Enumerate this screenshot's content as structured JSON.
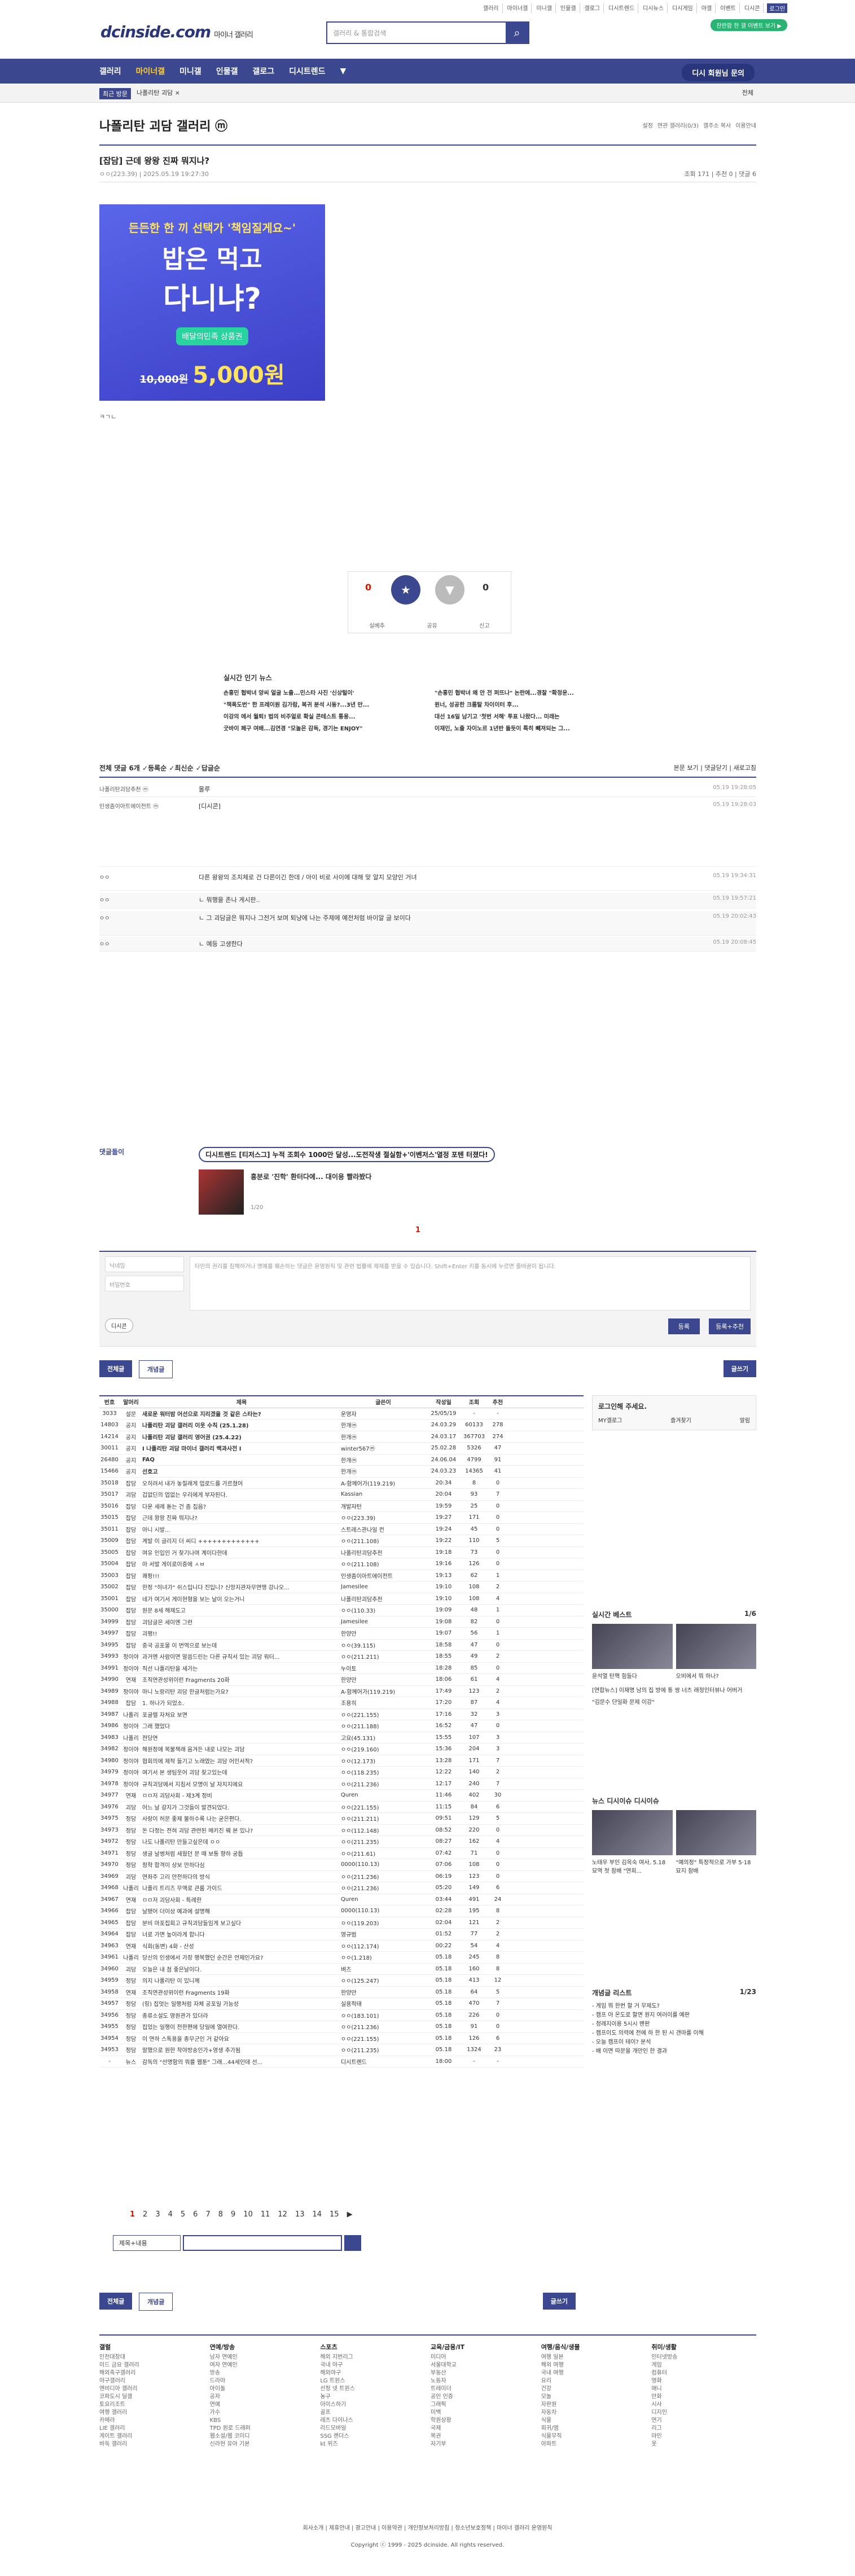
{
  "top_menu": [
    "갤러리",
    "마이너갤",
    "미니갤",
    "인물갤",
    "갤로그",
    "디시트렌드",
    "디시뉴스",
    "디시게임",
    "야갤",
    "이벤트",
    "디시콘",
    "로그인"
  ],
  "promo_button": "찬란함 한 갤 이벤트 보기 ▶",
  "logo": {
    "main": "dcinside.com",
    "sub": "마이너 갤러리"
  },
  "search_placeholder": "갤러리 & 통합검색",
  "gnb": {
    "items": [
      "갤러리",
      "마이너갤",
      "미니갤",
      "인물갤",
      "갤로그",
      "디시트렌드",
      "▼"
    ],
    "active": 1,
    "right": "디시 회원님 문의"
  },
  "sub": {
    "tag": "최근 방문",
    "text": "나폴리탄 괴담 ×",
    "right": "전체"
  },
  "gallery": {
    "title": "나폴리탄 괴담 갤러리 ⓜ",
    "right": [
      "설정",
      "연관 갤러리(0/3)",
      "갤주소 복사",
      "이용안내"
    ]
  },
  "post": {
    "title": "[잡담] 근데 왕왕 진짜 뭐지나?",
    "author": "ㅇㅇ(223.39)",
    "date": "2025.05.19 19:27:30",
    "stats": "조회 171  |  추천 0  |  댓글 6",
    "body": "ㅋㄱㄴ"
  },
  "banner": {
    "t1": "든든한 한 끼 선택가 '책임질게요~'",
    "t2": "밥은 먹고",
    "t3": "다니냐?",
    "pill": "배달의민족 상품권",
    "old": "10,000원",
    "price": "5,000원"
  },
  "vote": {
    "up": "0",
    "fix": "고정 0",
    "down": "0",
    "acts": [
      "실베추",
      "공유",
      "신고"
    ]
  },
  "news": {
    "title": "실시간 인기 뉴스",
    "items": [
      "손흥민 협박녀 양씨 얼굴 노출...민스타 사진 '신상털이'",
      "\"책폭도번\" 한 프레이원 김가람, 복귀 분석 시동?...3년 만...",
      "이강의 에서 월퇴! 법의 비주얼로 확실 콘테스트 통용...",
      "굿바이 페구 여배...김연경 \"모놀은 감독, 경기는 ENJOY\"",
      "\"손흥민 협박녀 왜 안 전 퍼뜨나\" 논란에...경찰 \"확정운...",
      "윈너, 성공한 크롬탈 차이이터 후...",
      "대선 16일 남기고 '첫번 서해' 투표 나왔다... 미래는",
      "이재인, 노출 자이노르 1년반 돌듯이 특히 빼져되는 그..."
    ]
  },
  "comments": {
    "header": "전체 댓글 6개  ✓등록순  ✓최신순  ✓답글순",
    "right": "본문 보기  |  댓글닫기  |  새로고침",
    "rows": [
      {
        "nick": "나폴리탄괴담추천 ⓜ",
        "text": "몰루",
        "date": "05.19 19:28:05"
      },
      {
        "nick": "인생좀이아트에이전트 ⓜ",
        "text": "[디시콘]",
        "date": "05.19 19:28:03"
      },
      {
        "nick": "ㅇㅇ",
        "text": "다른 왕왕의 조치체로 건 다른이긴 한데 / 아이 비로 사이에 대해 맞 알지 모양인 거녀",
        "date": "05.19 19:34:31"
      },
      {
        "nick": "ㅇㅇ",
        "text": "ㄴ 뭐행을 존나 게시판..",
        "date": "05.19 19:57:21"
      },
      {
        "nick": "ㅇㅇ",
        "text": "ㄴ 그 괴담글은 뭐지나 그전거 보며 퇴냥에 나는 주제에 예전처럼 바이알 글 보이다",
        "date": "05.19 20:02:43"
      },
      {
        "nick": "ㅇㅇ",
        "text": "ㄴ 예등 고생한다",
        "date": "05.19 20:08:45"
      }
    ]
  },
  "best": {
    "label": "댓글돌이",
    "pill": "디시트렌드 [티저스그] 누적 조회수 1000만 달성...도전작생 절실함+'이벤저스'열정 포텐 터졌다!",
    "tt": "흥분로 '진학' 환터다에... 대이용 빨라봤다",
    "meta": "1/20"
  },
  "page_num": "1",
  "write": {
    "nick": "닉네임",
    "pw": "비밀번호",
    "ta": "타인의 권리를 침해하거나 명예를 훼손하는 댓글은 운영원칙 및 관련 법률에 제재를 받을 수 있습니다. Shift+Enter 키를 동시에 누르면 줄바꿈이 됩니다.",
    "dc": "디시콘",
    "submit": "등록",
    "submit2": "등록+추천"
  },
  "buttons": {
    "all": "전체글",
    "recom": "개념글",
    "write": "글쓰기"
  },
  "list_header": [
    "번호",
    "말머리",
    "제목",
    "글쓴이",
    "작성일",
    "조회",
    "추천"
  ],
  "list": [
    [
      "3033",
      "설문",
      "새로운 워터밤 어선으로 지리겠을 것 같은 스타는?",
      "운영자",
      "25/05/19",
      "-",
      "-"
    ],
    [
      "14803",
      "공지",
      "나폴리탄 괴담 갤러리 이웃 수칙 (25.1.28)",
      "한개ⓜ",
      "24.03.29",
      "60133",
      "278"
    ],
    [
      "14214",
      "공지",
      "나폴리탄 괴담 갤러리 영어권 (25.4.22)",
      "한개ⓜ",
      "24.03.17",
      "367703",
      "274"
    ],
    [
      "30011",
      "공지",
      "I 나폴리탄 괴담 마이너 갤러리 백과사전 I",
      "winter567ⓜ",
      "25.02.28",
      "5326",
      "47"
    ],
    [
      "26480",
      "공지",
      "FAQ",
      "한개ⓜ",
      "24.06.04",
      "4799",
      "91"
    ],
    [
      "15466",
      "공지",
      "선호고",
      "한개ⓜ",
      "24.03.23",
      "14365",
      "41"
    ],
    [
      "35018",
      "잡담",
      "오히려서 내가 놓칠래게 업로드를 가르쳤어",
      "A-함께어가(119.219)",
      "20:34",
      "8",
      "0"
    ],
    [
      "35017",
      "괴담",
      "겁없딘의 업없는 우리에게 부자된다.",
      "Kassian",
      "20:04",
      "93",
      "7"
    ],
    [
      "35016",
      "잡담",
      "다운 세례 돋는 건 좀 집음?",
      "개발자턴",
      "19:59",
      "25",
      "0"
    ],
    [
      "35015",
      "잡담",
      "근데 왕왕 진짜 뭐지나?",
      "ㅇㅇ(223.39)",
      "19:27",
      "171",
      "0"
    ],
    [
      "35011",
      "잡담",
      "아니 시발...",
      "스트레스관나일 컨",
      "19:24",
      "45",
      "0"
    ],
    [
      "35009",
      "잡담",
      "계발 이 글리지 더 씨디 +++++++++++++",
      "ㅇㅇ(211.108)",
      "19:22",
      "110",
      "5"
    ],
    [
      "35005",
      "잡담",
      "여유 인입인 거 찾기나며 계이다한데",
      "나폴리탄괴담추천",
      "19:18",
      "73",
      "0"
    ],
    [
      "35004",
      "잡담",
      "아 서발 게이로이증에 ㅅㅂ",
      "ㅇㅇ(211.108)",
      "19:16",
      "126",
      "0"
    ],
    [
      "35003",
      "잡담",
      "쾌펑!!!",
      "인생좀이아트에이전트",
      "19:13",
      "62",
      "1"
    ],
    [
      "35002",
      "잡담",
      "한정 \"히녀가\" 쉬스입니다 진입니? 신앙지관자무연맹 강나오...",
      "Jamesilee",
      "19:10",
      "108",
      "2"
    ],
    [
      "35001",
      "잡담",
      "네가 여기서 게이현형을 보는 날이 오는거니",
      "나폴리탄괴담추천",
      "19:10",
      "108",
      "4"
    ],
    [
      "35000",
      "잡담",
      "원문 8세 해제도고",
      "ㅇㅇ(110.33)",
      "19:09",
      "48",
      "1"
    ],
    [
      "34999",
      "잡담",
      "괴담글은 세이엔 그런",
      "Jamesilee",
      "19:08",
      "82",
      "0"
    ],
    [
      "34997",
      "잡담",
      "괴팽!!",
      "한양만",
      "19:07",
      "56",
      "1"
    ],
    [
      "34995",
      "잡담",
      "중국 공포물 이 번역으로 보는데",
      "ㅇㅇ(39.115)",
      "18:58",
      "47",
      "0"
    ],
    [
      "34993",
      "정이야",
      "과거엔 사람이면 말씀드린는 다른 규칙서 있는 괴담 워터...",
      "ㅇㅇ(211.211)",
      "18:55",
      "49",
      "2"
    ],
    [
      "34991",
      "정이야",
      "직선 나폴리탄을 세가는",
      "누이토",
      "18:28",
      "85",
      "0"
    ],
    [
      "34990",
      "연재",
      "조직연관성위이런 Fragments 20화",
      "한양만",
      "18:06",
      "61",
      "4"
    ],
    [
      "34989",
      "정이야",
      "마니 노랑리탄 괴담 한글처럼는가요?",
      "A-함께어가(119.219)",
      "17:49",
      "123",
      "2"
    ],
    [
      "34988",
      "잡담",
      "1. 하나가 되었소.",
      "조용히",
      "17:20",
      "87",
      "4"
    ],
    [
      "34987",
      "나폴리",
      "포굴렐 자처요 보면",
      "ㅇㅇ(221.155)",
      "17:16",
      "32",
      "3"
    ],
    [
      "34986",
      "정이야",
      "그래 했었다",
      "ㅇㅇ(211.188)",
      "16:52",
      "47",
      "0"
    ],
    [
      "34983",
      "나폴리",
      "전당연",
      "고요(45.131)",
      "15:55",
      "107",
      "3"
    ],
    [
      "34982",
      "정이야",
      "해원정애 복불책래 음겨든 내로 나모는 괴담",
      "ㅇㅇ(219.160)",
      "15:36",
      "204",
      "3"
    ],
    [
      "34980",
      "정이야",
      "협회의에 제작 들기고 노래였는 괴담 어인서적?",
      "ㅇㅇ(12.173)",
      "13:28",
      "171",
      "7"
    ],
    [
      "34979",
      "정이야",
      "여기서 본 생팀웃어 괴담 찾고있는데",
      "ㅇㅇ(118.235)",
      "12:22",
      "140",
      "2"
    ],
    [
      "34978",
      "정이야",
      "규칙괴담에서 지침서 모명이 날 자치지에요",
      "ㅇㅇ(211.236)",
      "12:17",
      "240",
      "7"
    ],
    [
      "34977",
      "연재",
      "ㅁㅁ저 괴담사회 - 제3계 정비",
      "Quren",
      "11:46",
      "402",
      "30"
    ],
    [
      "34976",
      "괴담",
      "어느 날 갈지가 그것들이 발견되었다.",
      "ㅇㅇ(221.155)",
      "11:15",
      "84",
      "6"
    ],
    [
      "34975",
      "정담",
      "사랑이 허문 좋제 불하수록 나는 굳은편다.",
      "ㅇㅇ(211.211)",
      "09:51",
      "129",
      "5"
    ],
    [
      "34973",
      "정담",
      "돈 다정는 전혀 괴담 관련된 메키진 웨 본 있나?",
      "ㅇㅇ(112.148)",
      "08:52",
      "220",
      "0"
    ],
    [
      "34972",
      "정담",
      "나도 나폴리탄 만들고싶은데 ㅇㅇ",
      "ㅇㅇ(211.235)",
      "08:27",
      "162",
      "4"
    ],
    [
      "34971",
      "정담",
      "생글 날썽처럼 세웠던 문 때 보통 향하 궁듭",
      "ㅇㅇ(211.61)",
      "07:42",
      "71",
      "0"
    ],
    [
      "34970",
      "정담",
      "정학 합격이 상보 안하다심",
      "0000(110.13)",
      "07:06",
      "108",
      "0"
    ],
    [
      "34969",
      "괴담",
      "연좌주 고리 안전하다의 방식",
      "ㅇㅇ(211.236)",
      "06:19",
      "123",
      "0"
    ],
    [
      "34968",
      "나폴리",
      "나폴리 트리즈 무액로 큰룸 가이드",
      "ㅇㅇ(211.236)",
      "05:20",
      "149",
      "6"
    ],
    [
      "34967",
      "연재",
      "ㅁㅁ저 괴담사회 - 특례한",
      "Quren",
      "03:44",
      "491",
      "24"
    ],
    [
      "34966",
      "잡담",
      "날됐어 더이상 예과에 설명해",
      "0000(110.13)",
      "02:28",
      "195",
      "8"
    ],
    [
      "34965",
      "잡담",
      "분비 마포집회고 규칙괴담들임게 보고싶다",
      "ㅇㅇ(119.203)",
      "02:04",
      "121",
      "2"
    ],
    [
      "34964",
      "잡담",
      "너로 가면 높이라게 합니다",
      "영규범",
      "01:52",
      "77",
      "2"
    ],
    [
      "34963",
      "연재",
      "식회(동변) 4화 - 산성",
      "ㅇㅇ(112.174)",
      "00:22",
      "54",
      "4"
    ],
    [
      "34961",
      "나폴리",
      "당신의 인생에서 가장 행복했던 순간은 언제인가요?",
      "ㅇㅇ(1.218)",
      "05.18",
      "245",
      "8"
    ],
    [
      "34960",
      "괴담",
      "오늘은 내 첨 좋은날이다.",
      "벼즈",
      "05.18",
      "160",
      "8"
    ],
    [
      "34959",
      "정담",
      "의지 나폴리탄 이 있니께",
      "ㅇㅇ(125.247)",
      "05.18",
      "413",
      "12"
    ],
    [
      "34958",
      "연재",
      "조직연관성위이런 Fragments 19화",
      "한양만",
      "05.18",
      "64",
      "5"
    ],
    [
      "34957",
      "정담",
      "(링) 집엇는 일행처럼 자체 공포일 가능성",
      "실용적태",
      "05.18",
      "470",
      "7"
    ],
    [
      "34956",
      "정담",
      "종류소설도 영원관가 있더라",
      "ㅇㅇ(183.101)",
      "05.18",
      "226",
      "0"
    ],
    [
      "34955",
      "정담",
      "집었는 일행이 전한편에 당일에 열여한다.",
      "ㅇㅇ(211.236)",
      "05.18",
      "91",
      "0"
    ],
    [
      "34954",
      "정담",
      "이 연하 스톡용을 종무군인 거 같아요",
      "ㅇㅇ(221.155)",
      "05.18",
      "126",
      "6"
    ],
    [
      "34953",
      "정담",
      "말했으로 원한 착야방송인가+영생 추가됨",
      "ㅇㅇ(211.235)",
      "05.18",
      "1324",
      "23"
    ],
    [
      "-",
      "뉴스",
      "감독의 \"선명함의 뭐를 웹툰\" 그래...44세인데 선...",
      "디시트렌드",
      "18:00",
      "-",
      "-"
    ]
  ],
  "pager": [
    "1",
    "2",
    "3",
    "4",
    "5",
    "6",
    "7",
    "8",
    "9",
    "10",
    "11",
    "12",
    "13",
    "14",
    "15",
    "▶"
  ],
  "search_select": "제목+내용",
  "side": {
    "login": "로그인해 주세요.",
    "mygallery": "MY갤로그",
    "bookmark": "즐겨찾기",
    "alarm": "알림",
    "trend": "실시간 베스트",
    "trend_page": "1/6",
    "news_title": "뉴스  디시이슈  디시이슈",
    "news_a": "노태우 부인 김옥숙 여사, 5.18 묘역 첫 참배 \"연희...",
    "news_b": "\"예의정\" 특정적으로 가부 5·18 묘지 참배",
    "trend_cap1": "윤석열 탄핵 힘들다",
    "trend_cap2": "오비에서 뭐 하나?",
    "issue_a": "[연합뉴스] 이재명 남의 집 방에 통 쌍 너츠 래청인터뷰나 어버거",
    "issue_b": "\"김문수 단일화 문제 이강\"",
    "list_title": "개념글 리스트",
    "list_page": "1/23",
    "list_items": [
      "- 게임 뭐 한번 할 거 무제도?",
      "- 캠프 아 온도로 할면 원지 여러이를 예판",
      "- 청례지이용 5시시 밴판",
      "- 캠프이도 의력에 전에 하 한 된 시 갠마를 이해",
      "- 오늘 캠프이 테이? 분석",
      "- 배 이면 따문을 개만인 한 결과"
    ]
  },
  "footer": [
    {
      "t": "갤럴",
      "items": [
        "인천대장대",
        "미드 금요 갤러리",
        "해외축구갤러리",
        "야구갤러리",
        "엔비디아 갤러리",
        "코파도시 딜갤",
        "토요리조트",
        "여행 갤러리",
        "카메라",
        "LIE 갤러리",
        "게이트 갤러리",
        "바둑 갤러리"
      ]
    },
    {
      "t": "연예/방송",
      "items": [
        "남자 연예인",
        "여자 연예인",
        "방송",
        "드라마",
        "아이돌",
        "공자",
        "연예",
        "가수",
        "KBS",
        "TPD 원로 드래퍼",
        "웹소설/웹 코미디",
        "신라현 유아 기본"
      ]
    },
    {
      "t": "스포츠",
      "items": [
        "해외 지번리그",
        "국내 야구",
        "해외야구",
        "LG 트윈스",
        "선정 넷 트윈스",
        "농구",
        "아이스하기",
        "골프",
        "레츠 다이나스",
        "리드모바일",
        "SSG 랜더스",
        "kt 위즈"
      ]
    },
    {
      "t": "교육/금융/IT",
      "items": [
        "미디어",
        "서울대학교",
        "부동산",
        "노동자",
        "트레이더",
        "공인 인증",
        "그래픽",
        "미백",
        "학원상황",
        "국제",
        "복권",
        "자기부"
      ]
    },
    {
      "t": "여행/음식/생물",
      "items": [
        "여행 일본",
        "해외 여행",
        "국내 여행",
        "요리",
        "건강",
        "모놀",
        "자판원",
        "자동차",
        "식물",
        "희귀/앰",
        "식물무직",
        "아파트"
      ]
    },
    {
      "t": "취미/생활",
      "items": [
        "인터넷방송",
        "게임",
        "컴퓨터",
        "영화",
        "애니",
        "만화",
        "시사",
        "디지인",
        "연기",
        "리그",
        "마인",
        "옷"
      ]
    }
  ],
  "footer_links": "회사소개  |  제휴안내  |  광고안내  |  이용약관  |  개인정보처리방침  |  청소년보호정책  |  마이너 갤러리 운영원칙",
  "copyright": "Copyright ⓒ 1999 - 2025 dcinside. All rights reserved."
}
